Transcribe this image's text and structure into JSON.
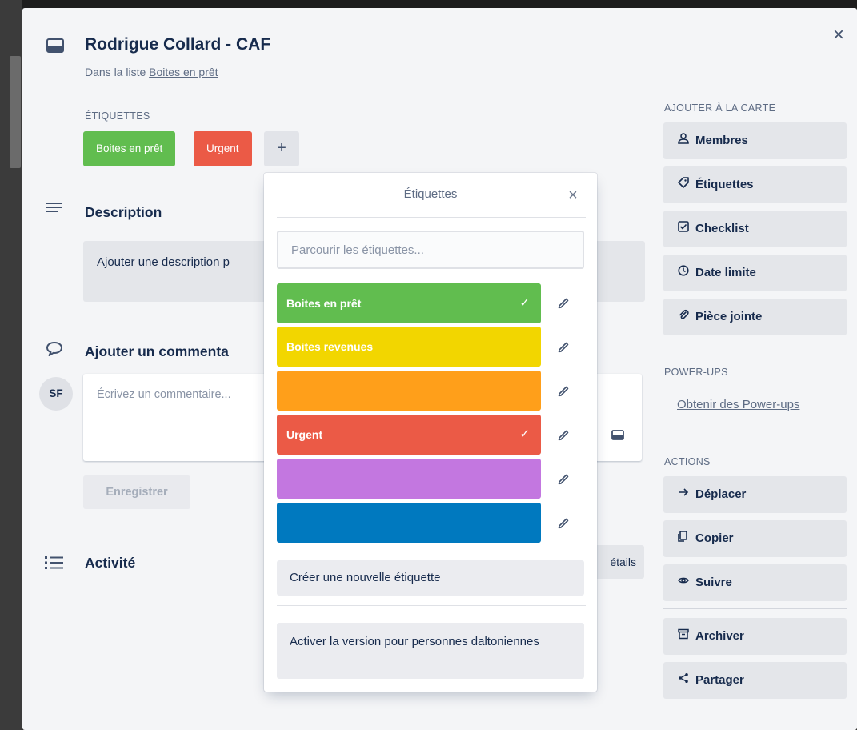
{
  "card": {
    "title": "Rodrigue Collard - CAF",
    "in_list_prefix": "Dans la liste ",
    "list_name": "Boites en prêt",
    "close_icon": "×"
  },
  "labels_section": {
    "heading": "ÉTIQUETTES",
    "chips": [
      {
        "text": "Boites en prêt",
        "color": "#61bd4f"
      },
      {
        "text": "Urgent",
        "color": "#eb5a46"
      }
    ],
    "add_symbol": "+"
  },
  "description": {
    "heading": "Description",
    "placeholder": "Ajouter une description p"
  },
  "comment": {
    "heading": "Ajouter un commenta",
    "avatar_initials": "SF",
    "placeholder": "Écrivez un commentaire...",
    "save_label": "Enregistrer"
  },
  "activity": {
    "heading": "Activité",
    "details_label": "étails"
  },
  "sidebar": {
    "add_heading": "AJOUTER À LA CARTE",
    "add_items": [
      {
        "label": "Membres",
        "icon": "person-icon"
      },
      {
        "label": "Étiquettes",
        "icon": "tag-icon"
      },
      {
        "label": "Checklist",
        "icon": "checkbox-icon"
      },
      {
        "label": "Date limite",
        "icon": "clock-icon"
      },
      {
        "label": "Pièce jointe",
        "icon": "paperclip-icon"
      }
    ],
    "powerups_heading": "POWER-UPS",
    "powerups_link": "Obtenir des Power-ups",
    "actions_heading": "ACTIONS",
    "action_items": [
      {
        "label": "Déplacer",
        "icon": "arrow-right-icon"
      },
      {
        "label": "Copier",
        "icon": "copy-icon"
      },
      {
        "label": "Suivre",
        "icon": "eye-icon"
      },
      {
        "label": "Archiver",
        "icon": "archive-icon"
      },
      {
        "label": "Partager",
        "icon": "share-icon"
      }
    ]
  },
  "labels_popover": {
    "title": "Étiquettes",
    "close_icon": "×",
    "search_placeholder": "Parcourir les étiquettes...",
    "labels": [
      {
        "text": "Boites en prêt",
        "color": "#61bd4f",
        "checked": true
      },
      {
        "text": "Boites revenues",
        "color": "#f2d600",
        "checked": false
      },
      {
        "text": "",
        "color": "#ff9f1a",
        "checked": false
      },
      {
        "text": "Urgent",
        "color": "#eb5a46",
        "checked": true
      },
      {
        "text": "",
        "color": "#c377e0",
        "checked": false
      },
      {
        "text": "",
        "color": "#0079bf",
        "checked": false
      }
    ],
    "check_mark": "✓",
    "create_label": "Créer une nouvelle étiquette",
    "colorblind_label": "Activer la version pour personnes daltoniennes"
  }
}
